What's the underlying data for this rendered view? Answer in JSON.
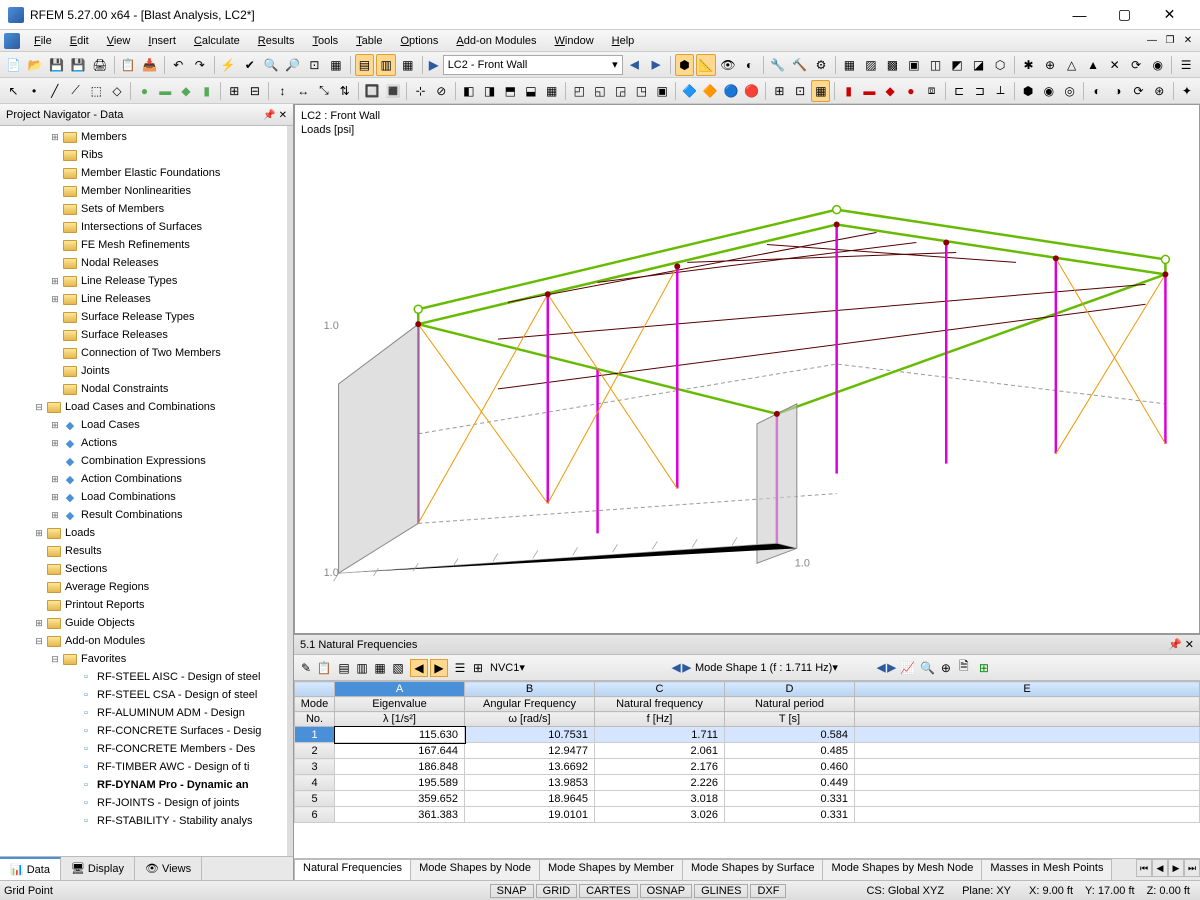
{
  "titlebar": {
    "text": "RFEM 5.27.00 x64 - [Blast Analysis, LC2*]"
  },
  "menu": [
    "File",
    "Edit",
    "View",
    "Insert",
    "Calculate",
    "Results",
    "Tools",
    "Table",
    "Options",
    "Add-on Modules",
    "Window",
    "Help"
  ],
  "combo_loadcase": "LC2 - Front Wall",
  "navigator": {
    "title": "Project Navigator - Data",
    "items": [
      {
        "indent": 3,
        "toggle": "+",
        "icon": "folder",
        "label": "Members"
      },
      {
        "indent": 3,
        "toggle": "",
        "icon": "folder",
        "label": "Ribs"
      },
      {
        "indent": 3,
        "toggle": "",
        "icon": "folder",
        "label": "Member Elastic Foundations"
      },
      {
        "indent": 3,
        "toggle": "",
        "icon": "folder",
        "label": "Member Nonlinearities"
      },
      {
        "indent": 3,
        "toggle": "",
        "icon": "folder",
        "label": "Sets of Members"
      },
      {
        "indent": 3,
        "toggle": "",
        "icon": "folder",
        "label": "Intersections of Surfaces"
      },
      {
        "indent": 3,
        "toggle": "",
        "icon": "folder",
        "label": "FE Mesh Refinements"
      },
      {
        "indent": 3,
        "toggle": "",
        "icon": "folder",
        "label": "Nodal Releases"
      },
      {
        "indent": 3,
        "toggle": "+",
        "icon": "folder",
        "label": "Line Release Types"
      },
      {
        "indent": 3,
        "toggle": "+",
        "icon": "folder",
        "label": "Line Releases"
      },
      {
        "indent": 3,
        "toggle": "",
        "icon": "folder",
        "label": "Surface Release Types"
      },
      {
        "indent": 3,
        "toggle": "",
        "icon": "folder",
        "label": "Surface Releases"
      },
      {
        "indent": 3,
        "toggle": "",
        "icon": "folder",
        "label": "Connection of Two Members"
      },
      {
        "indent": 3,
        "toggle": "",
        "icon": "folder",
        "label": "Joints"
      },
      {
        "indent": 3,
        "toggle": "",
        "icon": "folder",
        "label": "Nodal Constraints"
      },
      {
        "indent": 2,
        "toggle": "-",
        "icon": "folder",
        "label": "Load Cases and Combinations"
      },
      {
        "indent": 3,
        "toggle": "+",
        "icon": "item",
        "label": "Load Cases"
      },
      {
        "indent": 3,
        "toggle": "+",
        "icon": "item",
        "label": "Actions"
      },
      {
        "indent": 3,
        "toggle": "",
        "icon": "item",
        "label": "Combination Expressions"
      },
      {
        "indent": 3,
        "toggle": "+",
        "icon": "item",
        "label": "Action Combinations"
      },
      {
        "indent": 3,
        "toggle": "+",
        "icon": "item",
        "label": "Load Combinations"
      },
      {
        "indent": 3,
        "toggle": "+",
        "icon": "item",
        "label": "Result Combinations"
      },
      {
        "indent": 2,
        "toggle": "+",
        "icon": "folder",
        "label": "Loads"
      },
      {
        "indent": 2,
        "toggle": "",
        "icon": "folder",
        "label": "Results"
      },
      {
        "indent": 2,
        "toggle": "",
        "icon": "folder",
        "label": "Sections"
      },
      {
        "indent": 2,
        "toggle": "",
        "icon": "folder",
        "label": "Average Regions"
      },
      {
        "indent": 2,
        "toggle": "",
        "icon": "folder",
        "label": "Printout Reports"
      },
      {
        "indent": 2,
        "toggle": "+",
        "icon": "folder",
        "label": "Guide Objects"
      },
      {
        "indent": 2,
        "toggle": "-",
        "icon": "folder",
        "label": "Add-on Modules"
      },
      {
        "indent": 3,
        "toggle": "-",
        "icon": "folder",
        "label": "Favorites"
      },
      {
        "indent": 4,
        "toggle": "",
        "icon": "mod",
        "label": "RF-STEEL AISC - Design of steel"
      },
      {
        "indent": 4,
        "toggle": "",
        "icon": "mod",
        "label": "RF-STEEL CSA - Design of steel"
      },
      {
        "indent": 4,
        "toggle": "",
        "icon": "mod",
        "label": "RF-ALUMINUM ADM - Design"
      },
      {
        "indent": 4,
        "toggle": "",
        "icon": "mod",
        "label": "RF-CONCRETE Surfaces - Desig"
      },
      {
        "indent": 4,
        "toggle": "",
        "icon": "mod",
        "label": "RF-CONCRETE Members - Des"
      },
      {
        "indent": 4,
        "toggle": "",
        "icon": "mod",
        "label": "RF-TIMBER AWC - Design of ti"
      },
      {
        "indent": 4,
        "toggle": "",
        "icon": "mod",
        "label": "RF-DYNAM Pro - Dynamic an",
        "bold": true
      },
      {
        "indent": 4,
        "toggle": "",
        "icon": "mod",
        "label": "RF-JOINTS - Design of joints"
      },
      {
        "indent": 4,
        "toggle": "",
        "icon": "mod",
        "label": "RF-STABILITY - Stability analys"
      }
    ],
    "tabs": [
      "Data",
      "Display",
      "Views"
    ]
  },
  "viewport": {
    "line1": "LC2 : Front Wall",
    "line2": "Loads [psi]"
  },
  "tablepanel": {
    "title": "5.1 Natural Frequencies",
    "combo1": "NVC1",
    "combo2": "Mode Shape 1 (f : 1.711 Hz)",
    "columns": [
      "A",
      "B",
      "C",
      "D",
      "E"
    ],
    "headers1": [
      "Mode",
      "Eigenvalue",
      "Angular Frequency",
      "Natural frequency",
      "Natural period",
      ""
    ],
    "headers2": [
      "No.",
      "λ [1/s²]",
      "ω [rad/s]",
      "f [Hz]",
      "T [s]",
      ""
    ],
    "rows": [
      {
        "no": "1",
        "a": "115.630",
        "b": "10.7531",
        "c": "1.711",
        "d": "0.584",
        "sel": true
      },
      {
        "no": "2",
        "a": "167.644",
        "b": "12.9477",
        "c": "2.061",
        "d": "0.485"
      },
      {
        "no": "3",
        "a": "186.848",
        "b": "13.6692",
        "c": "2.176",
        "d": "0.460"
      },
      {
        "no": "4",
        "a": "195.589",
        "b": "13.9853",
        "c": "2.226",
        "d": "0.449"
      },
      {
        "no": "5",
        "a": "359.652",
        "b": "18.9645",
        "c": "3.018",
        "d": "0.331"
      },
      {
        "no": "6",
        "a": "361.383",
        "b": "19.0101",
        "c": "3.026",
        "d": "0.331"
      }
    ],
    "tabs": [
      "Natural Frequencies",
      "Mode Shapes by Node",
      "Mode Shapes by Member",
      "Mode Shapes by Surface",
      "Mode Shapes by Mesh Node",
      "Masses in Mesh Points"
    ]
  },
  "statusbar": {
    "left": "Grid Point",
    "snap": "SNAP",
    "grid": "GRID",
    "cartes": "CARTES",
    "osnap": "OSNAP",
    "glines": "GLINES",
    "dxf": "DXF",
    "cs": "CS: Global XYZ",
    "plane": "Plane: XY",
    "x": "X:   9.00 ft",
    "y": "Y:  17.00 ft",
    "z": "Z:   0.00 ft"
  }
}
